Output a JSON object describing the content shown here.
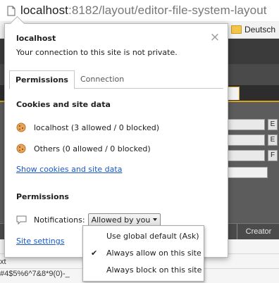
{
  "browser": {
    "url_host": "localhost",
    "url_path": ":8182/layout/editor-file-system-layout",
    "bookmark_folder": "Deutsch"
  },
  "background": {
    "tab_close": "×",
    "buttons": [
      "E",
      "E",
      "F"
    ],
    "table_header_creator": "Creator",
    "row_text_1": "xt",
    "row_text_2": "#4$5%6^7&8*9(0)-_"
  },
  "popup": {
    "title": "localhost",
    "subtitle": "Your connection to this site is not private.",
    "close": "×",
    "tabs": [
      {
        "label": "Permissions",
        "active": true
      },
      {
        "label": "Connection",
        "active": false
      }
    ],
    "cookies_title": "Cookies and site data",
    "cookie_rows": [
      {
        "text": "localhost (3 allowed / 0 blocked)",
        "icon": "cookie-icon"
      },
      {
        "text": "Others (0 allowed / 0 blocked)",
        "icon": "cookie-icon"
      }
    ],
    "show_cookies_link": "Show cookies and site data",
    "permissions_title": "Permissions",
    "notifications_label": "Notifications:",
    "notifications_value": "Allowed by you",
    "site_settings_link": "Site settings"
  },
  "dropdown": {
    "options": [
      {
        "label": "Use global default (Ask)",
        "checked": false
      },
      {
        "label": "Always allow on this site",
        "checked": true
      },
      {
        "label": "Always block on this site",
        "checked": false
      }
    ],
    "check_glyph": "✔"
  },
  "colors": {
    "link": "#1a57c8",
    "accent_tab_border": "#d9a21b",
    "cookie": "#d08a3a"
  }
}
